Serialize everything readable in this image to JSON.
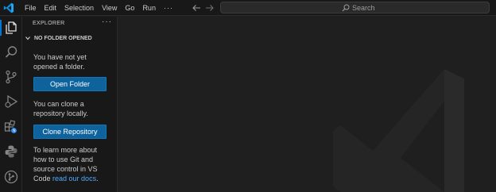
{
  "titlebar": {
    "menu": [
      "File",
      "Edit",
      "Selection",
      "View",
      "Go",
      "Run"
    ],
    "more": "···",
    "search_placeholder": "Search"
  },
  "activitybar": {
    "items": [
      "explorer-icon",
      "search-icon",
      "source-control-icon",
      "run-debug-icon",
      "extensions-icon",
      "python-icon",
      "git-graph-icon"
    ]
  },
  "sidebar": {
    "title": "EXPLORER",
    "more": "···",
    "section_label": "NO FOLDER OPENED",
    "msg1_line1": "You have not yet",
    "msg1_line2": "opened a folder.",
    "open_folder_button": "Open Folder",
    "msg2_line1": "You can clone a",
    "msg2_line2": "repository locally.",
    "clone_button": "Clone Repository",
    "msg3_line1": "To learn more about",
    "msg3_line2": "how to use Git and",
    "msg3_line3": "source control in VS",
    "msg3_line4_prefix": "Code ",
    "msg3_link": "read our docs",
    "msg3_suffix": "."
  },
  "colors": {
    "accent": "#0078d4",
    "button": "#0e639c",
    "link": "#4daafc",
    "editor_bg": "#1f1f1f",
    "chrome_bg": "#181818"
  }
}
